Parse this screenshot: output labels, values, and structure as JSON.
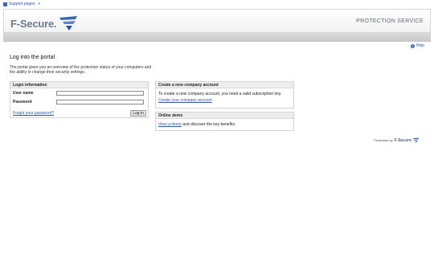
{
  "topbar": {
    "support_link": "Support pages"
  },
  "header": {
    "logo_text": "F-Secure.",
    "service_title": "PROTECTION SERVICE"
  },
  "help": {
    "label": "Help"
  },
  "main": {
    "title": "Log into the portal",
    "intro": "The portal gives you an overview of the protection status of your computers and the ability to change their security settings."
  },
  "login": {
    "header": "Login information",
    "username_label": "User name",
    "username_value": "",
    "password_label": "Password",
    "password_value": "",
    "forgot_link": "Forgot your password?",
    "login_button": "Log in"
  },
  "create": {
    "header": "Create a new company account",
    "text": "To create a new company account, you need a valid subscription key.",
    "link": "Create your company account"
  },
  "demo": {
    "header": "Online demo",
    "link": "View a demo",
    "text_after": " and discover the key benefits."
  },
  "footer": {
    "protection_by": "Protection by",
    "brand": "F-Secure"
  },
  "colors": {
    "link": "#3355aa",
    "logo": "#6c7b88",
    "accent": "#3b67b8"
  }
}
